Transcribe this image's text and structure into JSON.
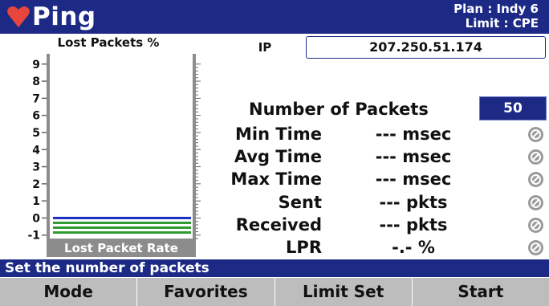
{
  "header": {
    "title": "Ping",
    "plan": "Plan : Indy 6",
    "limit": "Limit : CPE",
    "logo_color": "#e8453c"
  },
  "chart_data": {
    "type": "bar",
    "title": "Lost Packets %",
    "xlabel": "Lost Packet Rate",
    "ylabel": "",
    "y_ticks": [
      "9",
      "8",
      "7",
      "6",
      "5",
      "4",
      "3",
      "2",
      "1",
      "0",
      "-1"
    ],
    "ylim": [
      -1.2,
      9.6
    ],
    "grid": false,
    "series": [
      {
        "values": [
          0
        ],
        "color": "#1a2fbf"
      },
      {
        "values": [
          0
        ],
        "color": "#2c9a2c"
      }
    ]
  },
  "ip": {
    "label": "IP",
    "value": "207.250.51.174"
  },
  "packets": {
    "label": "Number of Packets",
    "value": "50"
  },
  "stats": [
    {
      "label": "Min Time",
      "value": "--- msec"
    },
    {
      "label": "Avg Time",
      "value": "--- msec"
    },
    {
      "label": "Max Time",
      "value": "--- msec"
    },
    {
      "label": "Sent",
      "value": "--- pkts"
    },
    {
      "label": "Received",
      "value": "--- pkts"
    },
    {
      "label": "LPR",
      "value": "-.- %"
    }
  ],
  "status": "Set the number of packets",
  "softkeys": [
    "Mode",
    "Favorites",
    "Limit Set",
    "Start"
  ],
  "colors": {
    "primary": "#1c2a86",
    "softkey_bg": "#bdbdbd",
    "chart_axis": "#8c8c8c"
  }
}
